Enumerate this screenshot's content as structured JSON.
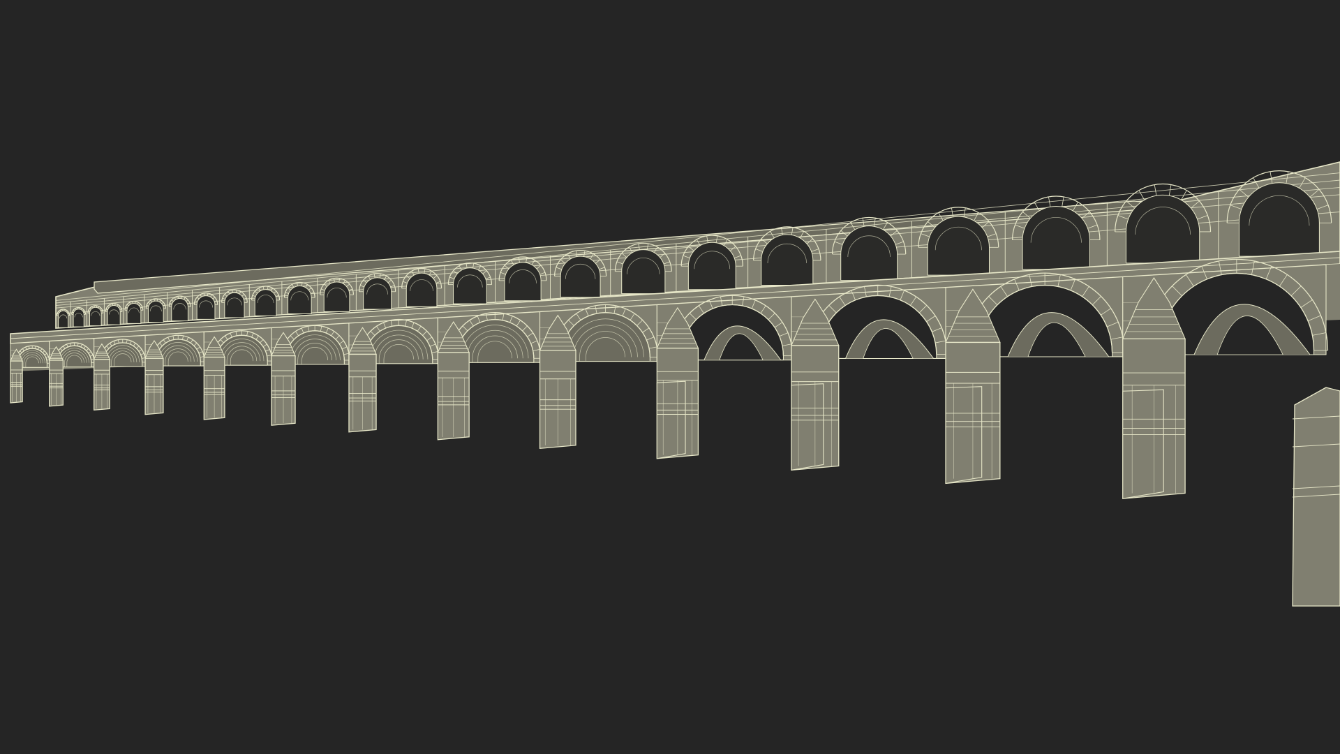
{
  "viewport": {
    "background": "#252525"
  },
  "model": {
    "subject": "aqueduct-wireframe",
    "style": "wireframe-on-solid",
    "fill_color": "#807f70",
    "fill_shadow_color": "#6c6b5e",
    "wire_color": "#e7e7c8",
    "upper_tier_arches": 25,
    "lower_tier_arches": 13
  }
}
